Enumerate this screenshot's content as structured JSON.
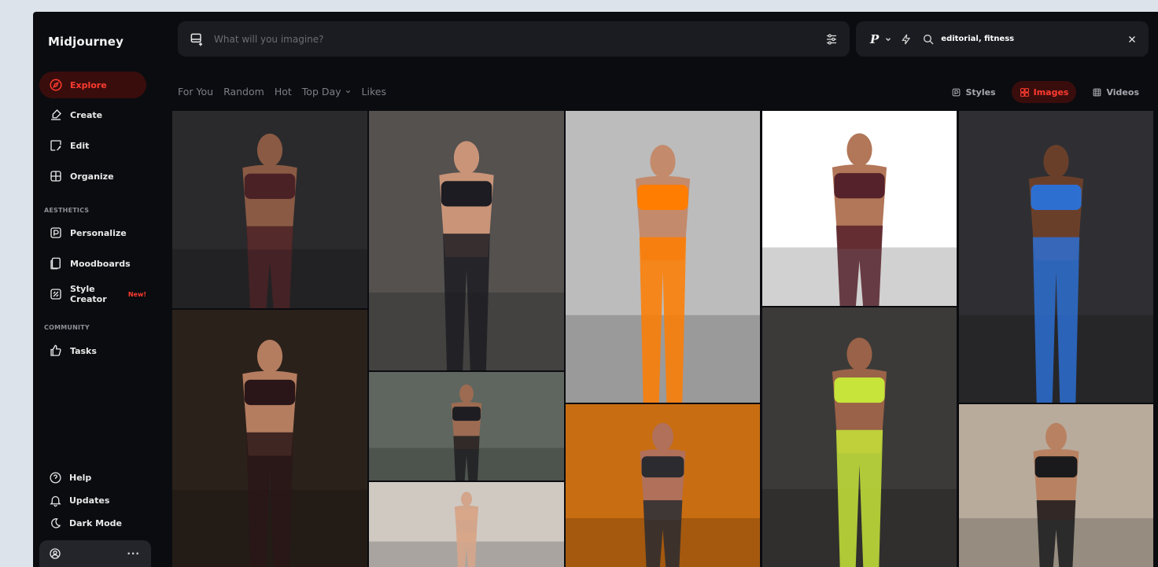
{
  "app": {
    "name": "Midjourney"
  },
  "sidebar": {
    "items": [
      {
        "label": "Explore",
        "icon": "compass-icon",
        "active": true
      },
      {
        "label": "Create",
        "icon": "paintbrush-icon"
      },
      {
        "label": "Edit",
        "icon": "edit-image-icon"
      },
      {
        "label": "Organize",
        "icon": "grid-icon"
      }
    ],
    "aesthetics_label": "AESTHETICS",
    "aesthetics": [
      {
        "label": "Personalize",
        "icon": "personalize-icon"
      },
      {
        "label": "Moodboards",
        "icon": "moodboard-icon"
      },
      {
        "label": "Style Creator",
        "icon": "style-creator-icon",
        "badge": "New!"
      }
    ],
    "community_label": "COMMUNITY",
    "community": [
      {
        "label": "Tasks",
        "icon": "thumbs-up-icon"
      }
    ],
    "bottom": [
      {
        "label": "Help",
        "icon": "help-circle-icon"
      },
      {
        "label": "Updates",
        "icon": "bell-icon"
      },
      {
        "label": "Dark Mode",
        "icon": "moon-icon"
      }
    ],
    "account_more": "···"
  },
  "prompt": {
    "placeholder": "What will you imagine?",
    "value": ""
  },
  "search": {
    "personalize_mark": "P",
    "value": "editorial, fitness"
  },
  "feed_tabs": [
    "For You",
    "Random",
    "Hot",
    "Top Day",
    "Likes"
  ],
  "media_tabs": [
    {
      "label": "Styles",
      "icon": "styles-icon"
    },
    {
      "label": "Images",
      "icon": "images-icon",
      "active": true
    },
    {
      "label": "Videos",
      "icon": "videos-icon"
    }
  ],
  "colors": {
    "accent": "#ff3b2f",
    "active_bg": "#3a0d0d",
    "app_bg": "#0b0c10",
    "field_bg": "#1b1c21"
  },
  "gallery": [
    {
      "bg": "#2a2a2c",
      "accent": "#4a2226",
      "skin": "#8a5a44"
    },
    {
      "bg": "#54514f",
      "accent": "#1c1c22",
      "skin": "#c99478"
    },
    {
      "bg": "#bcbcbc",
      "accent": "#ff7d00",
      "skin": "#c48a6c"
    },
    {
      "bg": "#ffffff",
      "accent": "#55212a",
      "skin": "#b27658"
    },
    {
      "bg": "#2f2f33",
      "accent": "#2d6fd1",
      "skin": "#6a3f2a"
    },
    {
      "bg": "#2b211b",
      "accent": "#2a1618",
      "skin": "#b47d60"
    },
    {
      "bg": "#5e665f",
      "accent": "#1e1e22",
      "skin": "#9c6b52"
    },
    {
      "bg": "#cfc9c2",
      "accent": "#d8a78a",
      "skin": "#d3a58b"
    },
    {
      "bg": "#c96d12",
      "accent": "#2b2b30",
      "skin": "#b0705a"
    },
    {
      "bg": "#3b3a38",
      "accent": "#c6e43a",
      "skin": "#9a6248"
    },
    {
      "bg": "#b8ab9c",
      "accent": "#1a1a1c",
      "skin": "#b88262"
    }
  ]
}
